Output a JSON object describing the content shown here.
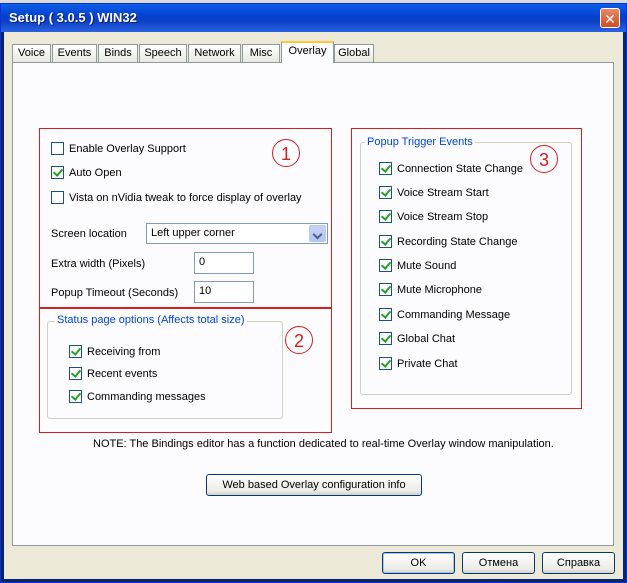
{
  "window": {
    "title": "Setup ( 3.0.5 ) WIN32",
    "close_glyph": "✕"
  },
  "tabs": [
    {
      "label": "Voice"
    },
    {
      "label": "Events"
    },
    {
      "label": "Binds"
    },
    {
      "label": "Speech"
    },
    {
      "label": "Network"
    },
    {
      "label": "Misc"
    },
    {
      "label": "Overlay",
      "active": true
    },
    {
      "label": "Global"
    }
  ],
  "section1": {
    "marker": "1",
    "enable_overlay": {
      "label": "Enable Overlay Support",
      "checked": false
    },
    "auto_open": {
      "label": "Auto Open",
      "checked": true
    },
    "vista_tweak": {
      "label": "Vista on nVidia tweak to force display of overlay",
      "checked": false
    },
    "screen_location": {
      "label": "Screen location",
      "value": "Left upper corner"
    },
    "extra_width": {
      "label": "Extra width (Pixels)",
      "value": "0"
    },
    "popup_timeout": {
      "label": "Popup Timeout (Seconds)",
      "value": "10"
    }
  },
  "section2": {
    "marker": "2",
    "group_title": "Status page options (Affects total size)",
    "items": [
      {
        "label": "Receiving from",
        "checked": true
      },
      {
        "label": "Recent events",
        "checked": true
      },
      {
        "label": "Commanding messages",
        "checked": true
      }
    ]
  },
  "section3": {
    "marker": "3",
    "group_title": "Popup Trigger Events",
    "items": [
      {
        "label": "Connection State Change",
        "checked": true
      },
      {
        "label": "Voice Stream Start",
        "checked": true
      },
      {
        "label": "Voice Stream Stop",
        "checked": true
      },
      {
        "label": "Recording State Change",
        "checked": true
      },
      {
        "label": "Mute Sound",
        "checked": true
      },
      {
        "label": "Mute Microphone",
        "checked": true
      },
      {
        "label": "Commanding Message",
        "checked": true
      },
      {
        "label": "Global Chat",
        "checked": true
      },
      {
        "label": "Private Chat",
        "checked": true
      }
    ]
  },
  "note": "NOTE: The Bindings editor has a function dedicated to real-time Overlay window manipulation.",
  "web_button": "Web based Overlay configuration info",
  "footer": {
    "ok": "OK",
    "cancel": "Отмена",
    "help": "Справка"
  }
}
